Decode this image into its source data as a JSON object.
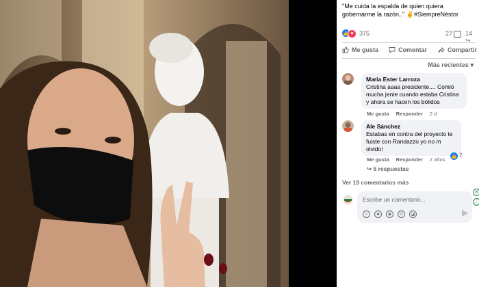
{
  "post": {
    "caption": "\"Me cuida la espalda de quien quiera gobernarme la razón..\" ✌️#SiempreNéstor",
    "reaction_count": "375",
    "comment_count": "27",
    "share_count": "14"
  },
  "actions": {
    "like": "Me gusta",
    "comment": "Comentar",
    "share": "Compartir"
  },
  "sort_label": "Más recientes",
  "comments": [
    {
      "author": "Maria Ester Larroza",
      "text": "Cristina aaaa presidente.... Comió mucha jente cuando estaba Cristina y ahora se hacen los bólidos",
      "like": "Me gusta",
      "reply": "Responder",
      "time": "2 d"
    },
    {
      "author": "Ale Sánchez",
      "text": "Estabas en contra del proyecto te fuiste con Randazzo yo no m olvido!",
      "like": "Me gusta",
      "reply": "Responder",
      "time": "2 años",
      "reactions": "2",
      "replies": "5 respuestas"
    }
  ],
  "more_comments": "Ver 19 comentarios más",
  "compose_placeholder": "Escribe un comentario...",
  "colors": {
    "like_blue": "#1877f2",
    "love_red": "#f33e58",
    "muted": "#65676b"
  }
}
